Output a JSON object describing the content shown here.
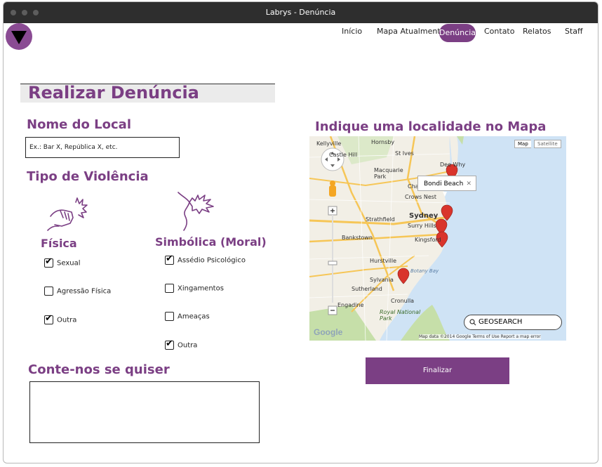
{
  "window": {
    "title": "Labrys - Denúncia"
  },
  "nav": {
    "items": [
      "Início",
      "Mapa Atualmente",
      "Denúncia",
      "Contato",
      "Relatos",
      "Staff"
    ],
    "active": "Denúncia"
  },
  "page": {
    "title": "Realizar Denúncia"
  },
  "local": {
    "heading": "Nome do Local",
    "placeholder": "Ex.: Bar X, República X, etc."
  },
  "violencia": {
    "heading": "Tipo de Violência",
    "fisica": {
      "title": "Física",
      "options": [
        {
          "label": "Sexual",
          "checked": true
        },
        {
          "label": "Agressão Física",
          "checked": false
        },
        {
          "label": "Outra",
          "checked": true
        }
      ]
    },
    "simbolica": {
      "title": "Simbólica (Moral)",
      "options": [
        {
          "label": "Assédio Psicológico",
          "checked": true
        },
        {
          "label": "Xingamentos",
          "checked": false
        },
        {
          "label": "Ameaças",
          "checked": false
        },
        {
          "label": "Outra",
          "checked": true
        }
      ]
    }
  },
  "conte": {
    "heading": "Conte-nos se quiser"
  },
  "map": {
    "heading": "Indique uma localidade no Mapa",
    "type_buttons": [
      "Map",
      "Satellite"
    ],
    "popup": "Bondi Beach",
    "search_label": "GEOSEARCH",
    "attribution": "Map data ©2014 Google   Terms of Use   Report a map error",
    "labels": [
      "Hornsby",
      "St Ives",
      "Dee Why",
      "Kellyville",
      "Castle Hill",
      "Macquarie Park",
      "Chatswood",
      "Crows Nest",
      "Sydney",
      "Surry Hills",
      "Strathfield",
      "Bankstown",
      "Kingsford",
      "Hurstville",
      "Sylvania",
      "Sutherland",
      "Cronulla",
      "Engadine",
      "Royal National Park",
      "Botany Bay"
    ],
    "colors": {
      "water": "#cfe3f5",
      "land": "#f2efe6",
      "park": "#c6dfa9",
      "marker": "#d9342b"
    }
  },
  "actions": {
    "submit": "Finalizar"
  },
  "colors": {
    "brand": "#7b3f84",
    "titlebar": "#2e2e2e"
  }
}
